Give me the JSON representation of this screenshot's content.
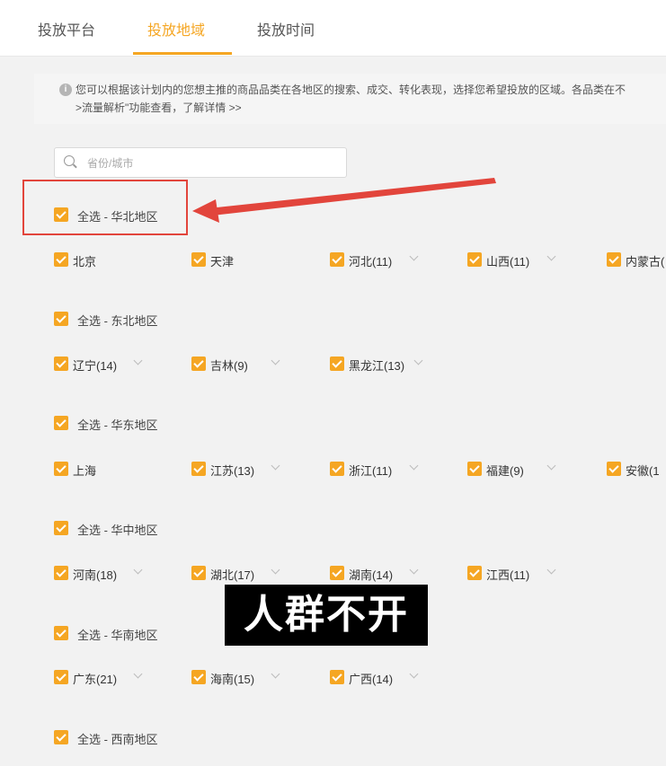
{
  "tabs": [
    {
      "label": "投放平台"
    },
    {
      "label": "投放地域"
    },
    {
      "label": "投放时间"
    }
  ],
  "notice": {
    "line1": "您可以根据该计划内的您想主推的商品品类在各地区的搜索、成交、转化表现，选择您希望投放的区域。各品类在不",
    "line2": ">流量解析\"功能查看，了解详情 >>"
  },
  "search": {
    "placeholder": "省份/城市"
  },
  "regions": {
    "north": "全选 - 华北地区",
    "northeast": "全选 - 东北地区",
    "east": "全选 - 华东地区",
    "central": "全选 - 华中地区",
    "south": "全选 - 华南地区",
    "southwest": "全选 - 西南地区"
  },
  "provinces": {
    "beijing": "北京",
    "tianjin": "天津",
    "hebei": "河北(11)",
    "shanxi": "山西(11)",
    "neimenggu": "内蒙古(",
    "liaoning": "辽宁(14)",
    "jilin": "吉林(9)",
    "heilongjiang": "黑龙江(13)",
    "shanghai": "上海",
    "jiangsu": "江苏(13)",
    "zhejiang": "浙江(11)",
    "fujian": "福建(9)",
    "anhui": "安徽(1",
    "henan": "河南(18)",
    "hubei": "湖北(17)",
    "hunan": "湖南(14)",
    "jiangxi": "江西(11)",
    "guangdong": "广东(21)",
    "hainan": "海南(15)",
    "guangxi": "广西(14)"
  },
  "subtitle": "人群不开",
  "colors": {
    "accent": "#f5a623",
    "annotation": "#e2453c"
  }
}
